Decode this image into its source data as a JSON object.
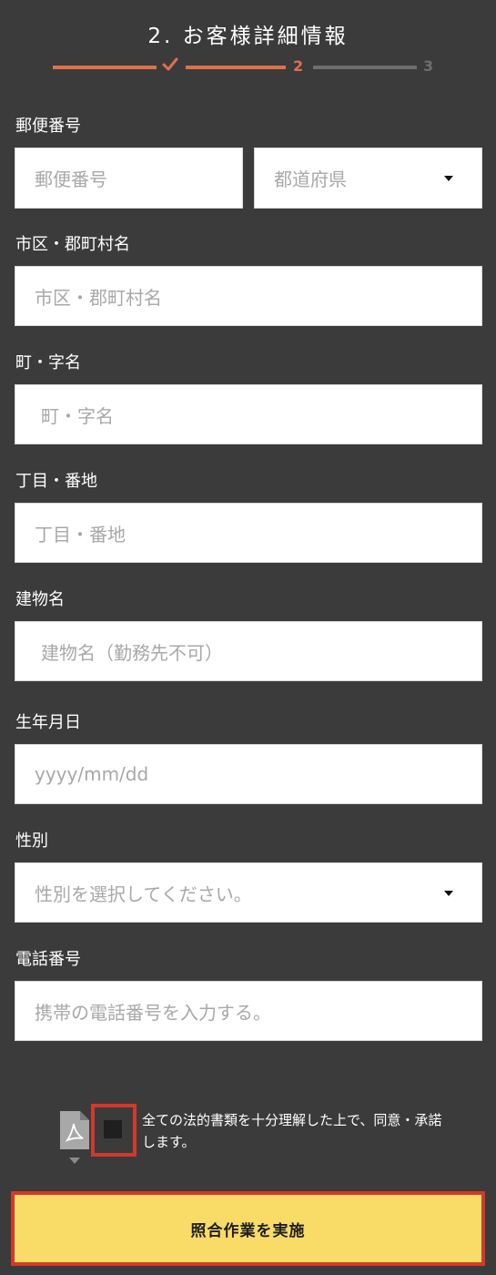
{
  "header": {
    "title": "2. お客様詳細情報",
    "steps": {
      "current": "2",
      "future": "3"
    },
    "colors": {
      "active": "#e0704a",
      "inactive": "#6e6e6e"
    }
  },
  "form": {
    "postal": {
      "label": "郵便番号",
      "placeholder": "郵便番号",
      "prefecture_placeholder": "都道府県"
    },
    "city": {
      "label": "市区・郡町村名",
      "placeholder": "市区・郡町村名"
    },
    "town": {
      "label": "町・字名",
      "placeholder": "町・字名"
    },
    "address": {
      "label": "丁目・番地",
      "placeholder": "丁目・番地"
    },
    "building": {
      "label": "建物名",
      "placeholder": "建物名（勤務先不可）"
    },
    "birthdate": {
      "label": "生年月日",
      "placeholder": "yyyy/mm/dd"
    },
    "gender": {
      "label": "性別",
      "placeholder": "性別を選択してください。"
    },
    "phone": {
      "label": "電話番号",
      "placeholder": "携帯の電話番号を入力する。"
    }
  },
  "agreement": {
    "icon": "pdf-icon",
    "text": "全ての法的書類を十分理解した上で、同意・承諾します。",
    "checked": false
  },
  "submit": {
    "label": "照合作業を実施",
    "color": "#f9dc68"
  }
}
